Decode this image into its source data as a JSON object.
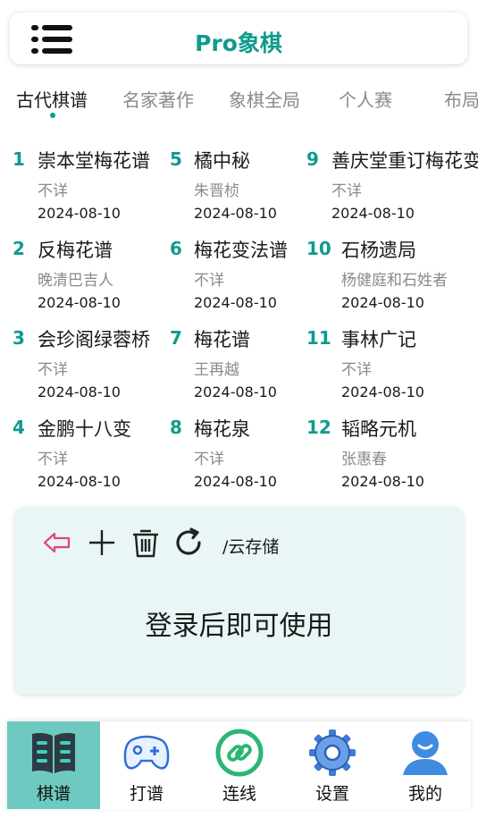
{
  "header": {
    "title": "Pro象棋",
    "menu_icon": "hamburger-menu-icon"
  },
  "tabs": [
    {
      "label": "古代棋谱",
      "active": true
    },
    {
      "label": "名家著作",
      "active": false
    },
    {
      "label": "象棋全局",
      "active": false
    },
    {
      "label": "个人赛",
      "active": false
    },
    {
      "label": "布局",
      "active": false
    }
  ],
  "books": [
    {
      "num": "1",
      "name": "崇本堂梅花谱",
      "author": "不详",
      "date": "2024-08-10"
    },
    {
      "num": "2",
      "name": "反梅花谱",
      "author": "晚清巴吉人",
      "date": "2024-08-10"
    },
    {
      "num": "3",
      "name": "会珍阁绿蓉桥",
      "author": "不详",
      "date": "2024-08-10"
    },
    {
      "num": "4",
      "name": "金鹏十八变",
      "author": "不详",
      "date": "2024-08-10"
    },
    {
      "num": "5",
      "name": "橘中秘",
      "author": "朱晋桢",
      "date": "2024-08-10"
    },
    {
      "num": "6",
      "name": "梅花变法谱",
      "author": "不详",
      "date": "2024-08-10"
    },
    {
      "num": "7",
      "name": "梅花谱",
      "author": "王再越",
      "date": "2024-08-10"
    },
    {
      "num": "8",
      "name": "梅花泉",
      "author": "不详",
      "date": "2024-08-10"
    },
    {
      "num": "9",
      "name": "善庆堂重订梅花变",
      "author": "不详",
      "date": "2024-08-10"
    },
    {
      "num": "10",
      "name": "石杨遗局",
      "author": "杨健庭和石姓者",
      "date": "2024-08-10"
    },
    {
      "num": "11",
      "name": "事林广记",
      "author": "不详",
      "date": "2024-08-10"
    },
    {
      "num": "12",
      "name": "韬略元机",
      "author": "张惠春",
      "date": "2024-08-10"
    }
  ],
  "cloud": {
    "path": "/云存储",
    "message": "登录后即可使用",
    "icons": [
      "back-arrow-icon",
      "plus-icon",
      "trash-icon",
      "refresh-icon"
    ]
  },
  "nav": [
    {
      "label": "棋谱",
      "icon": "book-icon",
      "active": true
    },
    {
      "label": "打谱",
      "icon": "gamepad-icon",
      "active": false
    },
    {
      "label": "连线",
      "icon": "link-icon",
      "active": false
    },
    {
      "label": "设置",
      "icon": "gear-icon",
      "active": false
    },
    {
      "label": "我的",
      "icon": "user-icon",
      "active": false
    }
  ],
  "colors": {
    "accent": "#0f9b8e",
    "nav_active_bg": "#6ec9c0",
    "cloud_bg": "#eaf6f5",
    "back_arrow": "#e0457b"
  }
}
